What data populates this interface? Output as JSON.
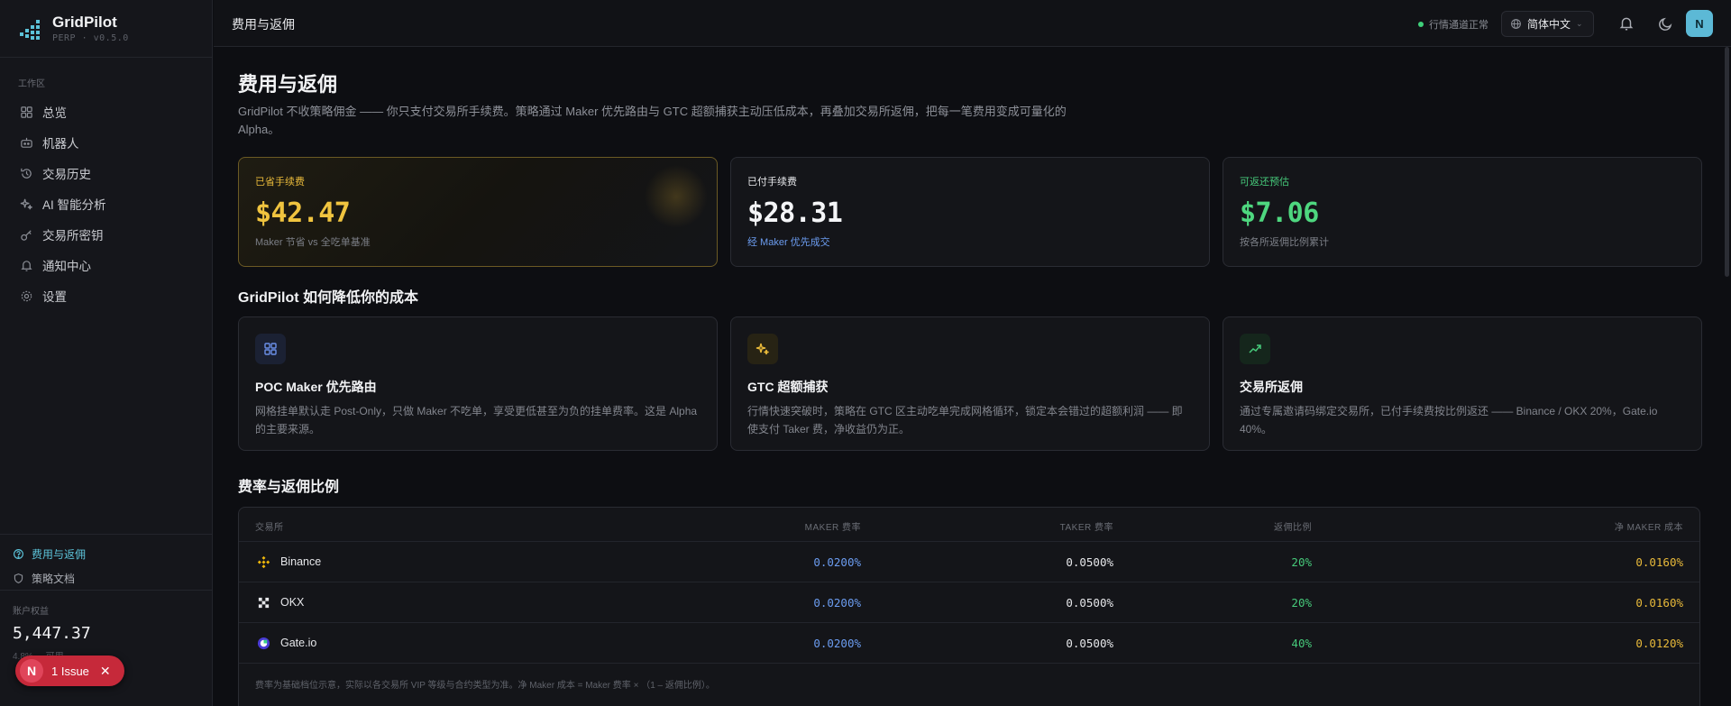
{
  "app": {
    "name": "GridPilot",
    "version": "PERP · v0.5.0"
  },
  "sidebar": {
    "section_label": "工作区",
    "items": [
      {
        "label": "总览",
        "icon": "grid-icon"
      },
      {
        "label": "机器人",
        "icon": "bot-icon"
      },
      {
        "label": "交易历史",
        "icon": "history-icon"
      },
      {
        "label": "AI 智能分析",
        "icon": "sparkle-icon"
      },
      {
        "label": "交易所密钥",
        "icon": "key-icon"
      },
      {
        "label": "通知中心",
        "icon": "bell-icon"
      },
      {
        "label": "设置",
        "icon": "gear-icon"
      }
    ],
    "bottom_items": [
      {
        "label": "费用与返佣",
        "icon": "fee-icon",
        "active": true
      },
      {
        "label": "策略文档",
        "icon": "shield-icon",
        "active": false
      }
    ],
    "equity": {
      "label": "账户权益",
      "value": "5,447.37",
      "sub": "4.8% ... 可用"
    },
    "issue": {
      "badge": "N",
      "label": "1 Issue"
    }
  },
  "topbar": {
    "title": "费用与返佣",
    "status": "行情通道正常",
    "language": "简体中文",
    "avatar": "N"
  },
  "page": {
    "title": "费用与返佣",
    "description": "GridPilot 不收策略佣金 —— 你只支付交易所手续费。策略通过 Maker 优先路由与 GTC 超额捕获主动压低成本，再叠加交易所返佣，把每一笔费用变成可量化的 Alpha。"
  },
  "stats": [
    {
      "label": "已省手续费",
      "value": "$42.47",
      "sub": "Maker 节省 vs 全吃单基准",
      "label_color": "#e8b93a",
      "value_color": "#f0c43f",
      "sub_color": "#7c7f87"
    },
    {
      "label": "已付手续费",
      "value": "$28.31",
      "sub": "经 Maker 优先成交",
      "label_color": "#e6e7ea",
      "value_color": "#f4f5f7",
      "sub_color": "#6b9cf0"
    },
    {
      "label": "可返还预估",
      "value": "$7.06",
      "sub": "按各所返佣比例累计",
      "label_color": "#46c97a",
      "value_color": "#4ed77f",
      "sub_color": "#7c7f87"
    }
  ],
  "how_section": {
    "title": "GridPilot 如何降低你的成本",
    "features": [
      {
        "title": "POC Maker 优先路由",
        "desc": "网格挂单默认走 Post-Only，只做 Maker 不吃单，享受更低甚至为负的挂单费率。这是 Alpha 的主要来源。",
        "icon": "grid-icon",
        "icon_color": "#6b8fe8",
        "icon_bg": "#1b2133"
      },
      {
        "title": "GTC 超额捕获",
        "desc": "行情快速突破时，策略在 GTC 区主动吃单完成网格循环，锁定本会错过的超额利润 —— 即使支付 Taker 费，净收益仍为正。",
        "icon": "sparkle-icon",
        "icon_color": "#e8b93a",
        "icon_bg": "#272314"
      },
      {
        "title": "交易所返佣",
        "desc": "通过专属邀请码绑定交易所，已付手续费按比例返还 —— Binance / OKX 20%，Gate.io 40%。",
        "icon": "trend-up-icon",
        "icon_color": "#46c97a",
        "icon_bg": "#15261c"
      }
    ]
  },
  "rates_section": {
    "title": "费率与返佣比例",
    "columns": [
      "交易所",
      "MAKER 费率",
      "TAKER 费率",
      "返佣比例",
      "净 MAKER 成本"
    ],
    "rows": [
      {
        "exchange": "Binance",
        "icon": "binance-icon",
        "maker": "0.0200%",
        "taker": "0.0500%",
        "rebate": "20%",
        "net": "0.0160%"
      },
      {
        "exchange": "OKX",
        "icon": "okx-icon",
        "maker": "0.0200%",
        "taker": "0.0500%",
        "rebate": "20%",
        "net": "0.0160%"
      },
      {
        "exchange": "Gate.io",
        "icon": "gate-icon",
        "maker": "0.0200%",
        "taker": "0.0500%",
        "rebate": "40%",
        "net": "0.0120%"
      }
    ],
    "footnote": "费率为基础档位示意，实际以各交易所 VIP 等级与合约类型为准。净 Maker 成本 = Maker 费率 × （1 – 返佣比例）。"
  },
  "colors": {
    "maker": "#6b9cf0",
    "rebate": "#46c97a",
    "net": "#e8b93a",
    "accent": "#5cc3d9"
  }
}
